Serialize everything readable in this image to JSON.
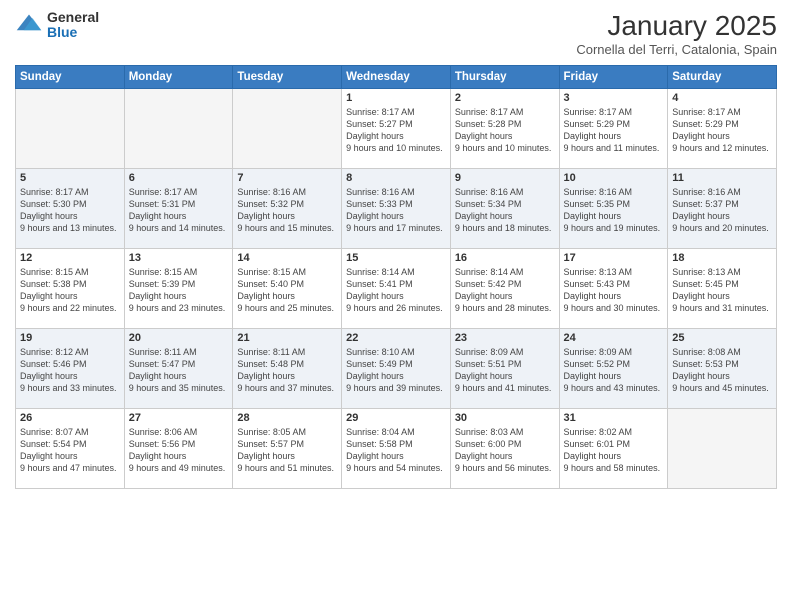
{
  "logo": {
    "general": "General",
    "blue": "Blue"
  },
  "header": {
    "month": "January 2025",
    "location": "Cornella del Terri, Catalonia, Spain"
  },
  "weekdays": [
    "Sunday",
    "Monday",
    "Tuesday",
    "Wednesday",
    "Thursday",
    "Friday",
    "Saturday"
  ],
  "weeks": [
    [
      {
        "day": "",
        "empty": true
      },
      {
        "day": "",
        "empty": true
      },
      {
        "day": "",
        "empty": true
      },
      {
        "day": "1",
        "sunrise": "8:17 AM",
        "sunset": "5:27 PM",
        "daylight": "9 hours and 10 minutes."
      },
      {
        "day": "2",
        "sunrise": "8:17 AM",
        "sunset": "5:28 PM",
        "daylight": "9 hours and 10 minutes."
      },
      {
        "day": "3",
        "sunrise": "8:17 AM",
        "sunset": "5:29 PM",
        "daylight": "9 hours and 11 minutes."
      },
      {
        "day": "4",
        "sunrise": "8:17 AM",
        "sunset": "5:29 PM",
        "daylight": "9 hours and 12 minutes."
      }
    ],
    [
      {
        "day": "5",
        "sunrise": "8:17 AM",
        "sunset": "5:30 PM",
        "daylight": "9 hours and 13 minutes."
      },
      {
        "day": "6",
        "sunrise": "8:17 AM",
        "sunset": "5:31 PM",
        "daylight": "9 hours and 14 minutes."
      },
      {
        "day": "7",
        "sunrise": "8:16 AM",
        "sunset": "5:32 PM",
        "daylight": "9 hours and 15 minutes."
      },
      {
        "day": "8",
        "sunrise": "8:16 AM",
        "sunset": "5:33 PM",
        "daylight": "9 hours and 17 minutes."
      },
      {
        "day": "9",
        "sunrise": "8:16 AM",
        "sunset": "5:34 PM",
        "daylight": "9 hours and 18 minutes."
      },
      {
        "day": "10",
        "sunrise": "8:16 AM",
        "sunset": "5:35 PM",
        "daylight": "9 hours and 19 minutes."
      },
      {
        "day": "11",
        "sunrise": "8:16 AM",
        "sunset": "5:37 PM",
        "daylight": "9 hours and 20 minutes."
      }
    ],
    [
      {
        "day": "12",
        "sunrise": "8:15 AM",
        "sunset": "5:38 PM",
        "daylight": "9 hours and 22 minutes."
      },
      {
        "day": "13",
        "sunrise": "8:15 AM",
        "sunset": "5:39 PM",
        "daylight": "9 hours and 23 minutes."
      },
      {
        "day": "14",
        "sunrise": "8:15 AM",
        "sunset": "5:40 PM",
        "daylight": "9 hours and 25 minutes."
      },
      {
        "day": "15",
        "sunrise": "8:14 AM",
        "sunset": "5:41 PM",
        "daylight": "9 hours and 26 minutes."
      },
      {
        "day": "16",
        "sunrise": "8:14 AM",
        "sunset": "5:42 PM",
        "daylight": "9 hours and 28 minutes."
      },
      {
        "day": "17",
        "sunrise": "8:13 AM",
        "sunset": "5:43 PM",
        "daylight": "9 hours and 30 minutes."
      },
      {
        "day": "18",
        "sunrise": "8:13 AM",
        "sunset": "5:45 PM",
        "daylight": "9 hours and 31 minutes."
      }
    ],
    [
      {
        "day": "19",
        "sunrise": "8:12 AM",
        "sunset": "5:46 PM",
        "daylight": "9 hours and 33 minutes."
      },
      {
        "day": "20",
        "sunrise": "8:11 AM",
        "sunset": "5:47 PM",
        "daylight": "9 hours and 35 minutes."
      },
      {
        "day": "21",
        "sunrise": "8:11 AM",
        "sunset": "5:48 PM",
        "daylight": "9 hours and 37 minutes."
      },
      {
        "day": "22",
        "sunrise": "8:10 AM",
        "sunset": "5:49 PM",
        "daylight": "9 hours and 39 minutes."
      },
      {
        "day": "23",
        "sunrise": "8:09 AM",
        "sunset": "5:51 PM",
        "daylight": "9 hours and 41 minutes."
      },
      {
        "day": "24",
        "sunrise": "8:09 AM",
        "sunset": "5:52 PM",
        "daylight": "9 hours and 43 minutes."
      },
      {
        "day": "25",
        "sunrise": "8:08 AM",
        "sunset": "5:53 PM",
        "daylight": "9 hours and 45 minutes."
      }
    ],
    [
      {
        "day": "26",
        "sunrise": "8:07 AM",
        "sunset": "5:54 PM",
        "daylight": "9 hours and 47 minutes."
      },
      {
        "day": "27",
        "sunrise": "8:06 AM",
        "sunset": "5:56 PM",
        "daylight": "9 hours and 49 minutes."
      },
      {
        "day": "28",
        "sunrise": "8:05 AM",
        "sunset": "5:57 PM",
        "daylight": "9 hours and 51 minutes."
      },
      {
        "day": "29",
        "sunrise": "8:04 AM",
        "sunset": "5:58 PM",
        "daylight": "9 hours and 54 minutes."
      },
      {
        "day": "30",
        "sunrise": "8:03 AM",
        "sunset": "6:00 PM",
        "daylight": "9 hours and 56 minutes."
      },
      {
        "day": "31",
        "sunrise": "8:02 AM",
        "sunset": "6:01 PM",
        "daylight": "9 hours and 58 minutes."
      },
      {
        "day": "",
        "empty": true
      }
    ]
  ]
}
